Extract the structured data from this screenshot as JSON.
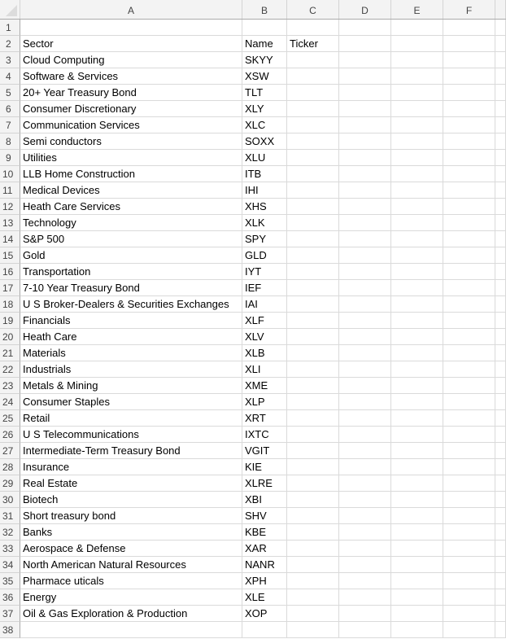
{
  "columns": [
    "A",
    "B",
    "C",
    "D",
    "E",
    "F"
  ],
  "header_row": {
    "row": "2",
    "sector": "Sector",
    "name": "Name",
    "ticker": "Ticker"
  },
  "empty_rows": {
    "first": "1",
    "last": "38"
  },
  "rows": [
    {
      "n": "3",
      "sector": "Cloud Computing",
      "name": "SKYY"
    },
    {
      "n": "4",
      "sector": "Software & Services",
      "name": "XSW"
    },
    {
      "n": "5",
      "sector": "20+ Year Treasury Bond",
      "name": "TLT"
    },
    {
      "n": "6",
      "sector": "Consumer Discretionary",
      "name": "XLY"
    },
    {
      "n": "7",
      "sector": "Communication Services",
      "name": "XLC"
    },
    {
      "n": "8",
      "sector": "Semi conductors",
      "name": "SOXX"
    },
    {
      "n": "9",
      "sector": "Utilities",
      "name": "XLU"
    },
    {
      "n": "10",
      "sector": "LLB Home Construction",
      "name": "ITB"
    },
    {
      "n": "11",
      "sector": "Medical Devices",
      "name": "IHI"
    },
    {
      "n": "12",
      "sector": "Heath Care Services",
      "name": "XHS"
    },
    {
      "n": "13",
      "sector": "Technology",
      "name": "XLK"
    },
    {
      "n": "14",
      "sector": "S&P 500",
      "name": "SPY"
    },
    {
      "n": "15",
      "sector": "Gold",
      "name": "GLD"
    },
    {
      "n": "16",
      "sector": "Transportation",
      "name": "IYT"
    },
    {
      "n": "17",
      "sector": "7-10 Year Treasury Bond",
      "name": "IEF"
    },
    {
      "n": "18",
      "sector": "U S Broker-Dealers & Securities Exchanges",
      "name": "IAI"
    },
    {
      "n": "19",
      "sector": "Financials",
      "name": "XLF"
    },
    {
      "n": "20",
      "sector": "Heath Care",
      "name": "XLV"
    },
    {
      "n": "21",
      "sector": "Materials",
      "name": "XLB"
    },
    {
      "n": "22",
      "sector": "Industrials",
      "name": "XLI"
    },
    {
      "n": "23",
      "sector": "Metals & Mining",
      "name": "XME"
    },
    {
      "n": "24",
      "sector": "Consumer Staples",
      "name": "XLP"
    },
    {
      "n": "25",
      "sector": "Retail",
      "name": "XRT"
    },
    {
      "n": "26",
      "sector": "U S Telecommunications",
      "name": "IXTC"
    },
    {
      "n": "27",
      "sector": "Intermediate-Term Treasury Bond",
      "name": "VGIT"
    },
    {
      "n": "28",
      "sector": "Insurance",
      "name": "KIE"
    },
    {
      "n": "29",
      "sector": "Real Estate",
      "name": "XLRE"
    },
    {
      "n": "30",
      "sector": "Biotech",
      "name": "XBI"
    },
    {
      "n": "31",
      "sector": "Short treasury bond",
      "name": "SHV"
    },
    {
      "n": "32",
      "sector": "Banks",
      "name": "KBE"
    },
    {
      "n": "33",
      "sector": "Aerospace & Defense",
      "name": "XAR"
    },
    {
      "n": "34",
      "sector": "North American Natural Resources",
      "name": "NANR"
    },
    {
      "n": "35",
      "sector": "Pharmace uticals",
      "name": "XPH"
    },
    {
      "n": "36",
      "sector": "Energy",
      "name": "XLE"
    },
    {
      "n": "37",
      "sector": "Oil & Gas Exploration & Production",
      "name": "XOP"
    }
  ]
}
